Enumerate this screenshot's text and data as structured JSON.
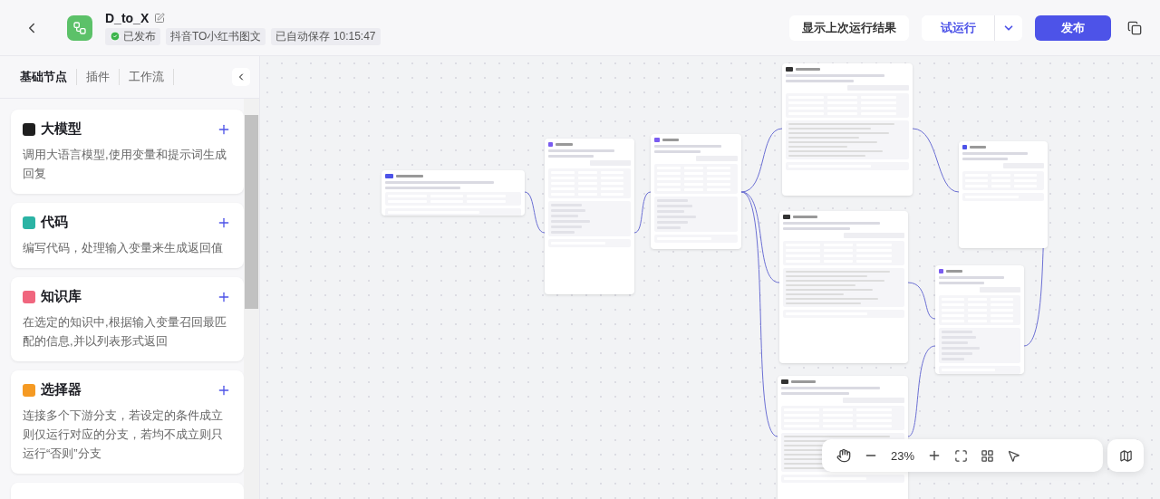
{
  "header": {
    "title": "D_to_X",
    "status": "已发布",
    "tags": [
      "抖音TO小红书图文",
      "已自动保存 10:15:47"
    ],
    "buttons": [
      {
        "label": "显示上次运行结果",
        "kind": "plain"
      },
      {
        "label": "试运行",
        "kind": "split"
      },
      {
        "label": "发布",
        "kind": "primary"
      }
    ]
  },
  "sidebar": {
    "tabs": [
      {
        "label": "基础节点",
        "selected": true
      },
      {
        "label": "插件",
        "selected": false
      },
      {
        "label": "工作流",
        "selected": false
      }
    ],
    "items": [
      {
        "title": "大模型",
        "description": "调用大语言模型,使用变量和提示词生成回复",
        "color": "#1f1f1f"
      },
      {
        "title": "代码",
        "description": "编写代码，处理输入变量来生成返回值",
        "color": "#2bb3a4"
      },
      {
        "title": "知识库",
        "description": "在选定的知识中,根据输入变量召回最匹配的信息,并以列表形式返回",
        "color": "#f0667e"
      },
      {
        "title": "选择器",
        "description": "连接多个下游分支，若设定的条件成立则仅运行对应的分支，若均不成立则只运行“否则”分支",
        "color": "#f59a23"
      }
    ]
  },
  "canvas": {
    "nodes": [
      {
        "kind": "start"
      },
      {
        "kind": "plugin"
      },
      {
        "kind": "plugin"
      },
      {
        "kind": "llm"
      },
      {
        "kind": "llm"
      },
      {
        "kind": "llm"
      },
      {
        "kind": "end"
      },
      {
        "kind": "plugin"
      }
    ],
    "zoom": "23%"
  }
}
